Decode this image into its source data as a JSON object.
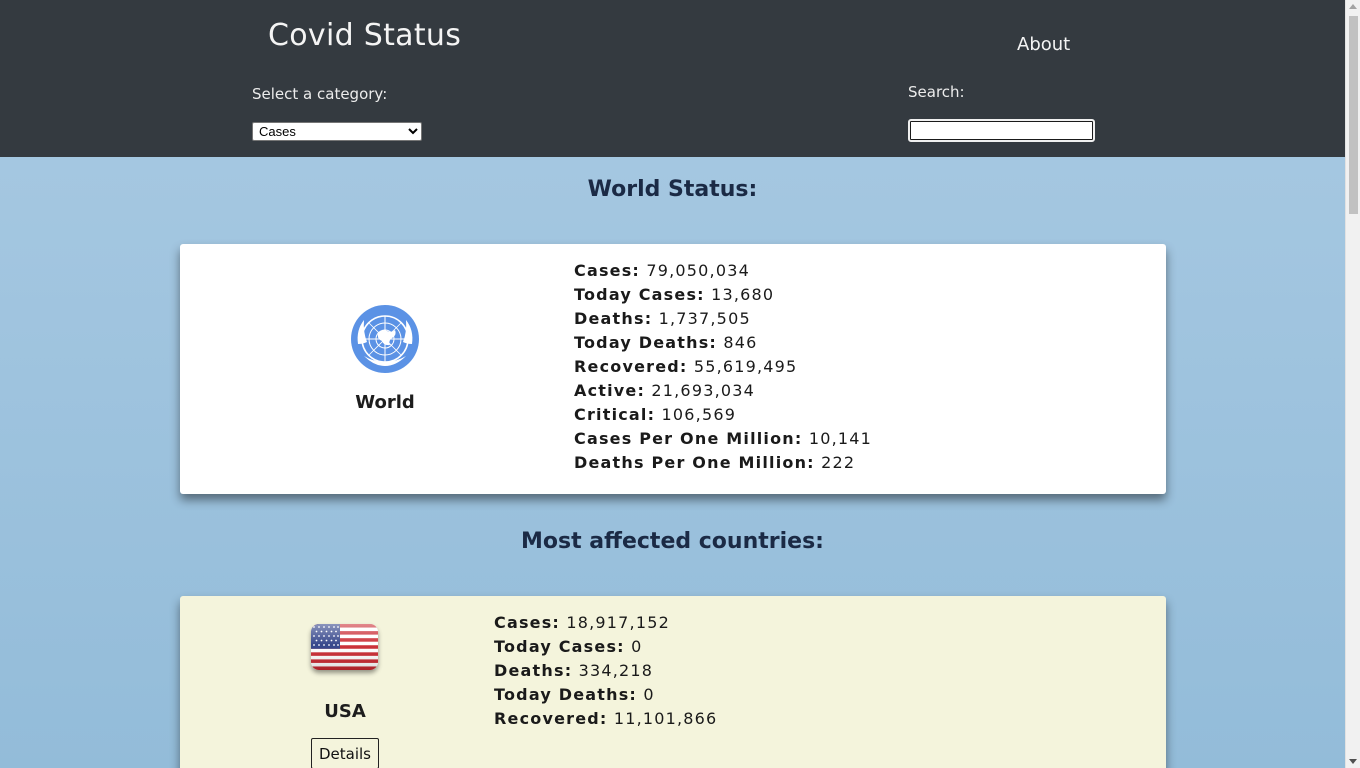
{
  "header": {
    "title": "Covid Status",
    "about_label": "About",
    "category_label": "Select a category:",
    "category_selected": "Cases",
    "search_label": "Search:",
    "search_value": ""
  },
  "world_section": {
    "heading": "World Status:",
    "name": "World",
    "icon": "un-emblem-icon",
    "stats": [
      {
        "label": "Cases:",
        "value": "79,050,034"
      },
      {
        "label": "Today Cases:",
        "value": "13,680"
      },
      {
        "label": "Deaths:",
        "value": "1,737,505"
      },
      {
        "label": "Today Deaths:",
        "value": "846"
      },
      {
        "label": "Recovered:",
        "value": "55,619,495"
      },
      {
        "label": "Active:",
        "value": "21,693,034"
      },
      {
        "label": "Critical:",
        "value": "106,569"
      },
      {
        "label": "Cases Per One Million:",
        "value": "10,141"
      },
      {
        "label": "Deaths Per One Million:",
        "value": "222"
      }
    ]
  },
  "countries_section": {
    "heading": "Most affected countries:",
    "countries": [
      {
        "name": "USA",
        "icon": "us-flag-icon",
        "details_label": "Details",
        "stats": [
          {
            "label": "Cases:",
            "value": "18,917,152"
          },
          {
            "label": "Today Cases:",
            "value": "0"
          },
          {
            "label": "Deaths:",
            "value": "334,218"
          },
          {
            "label": "Today Deaths:",
            "value": "0"
          },
          {
            "label": "Recovered:",
            "value": "11,101,866"
          }
        ]
      }
    ]
  },
  "colors": {
    "header_bg": "#343a40",
    "page_bg": "#a9cae3",
    "world_card_bg": "#ffffff",
    "country_card_bg": "#f4f4dc"
  }
}
